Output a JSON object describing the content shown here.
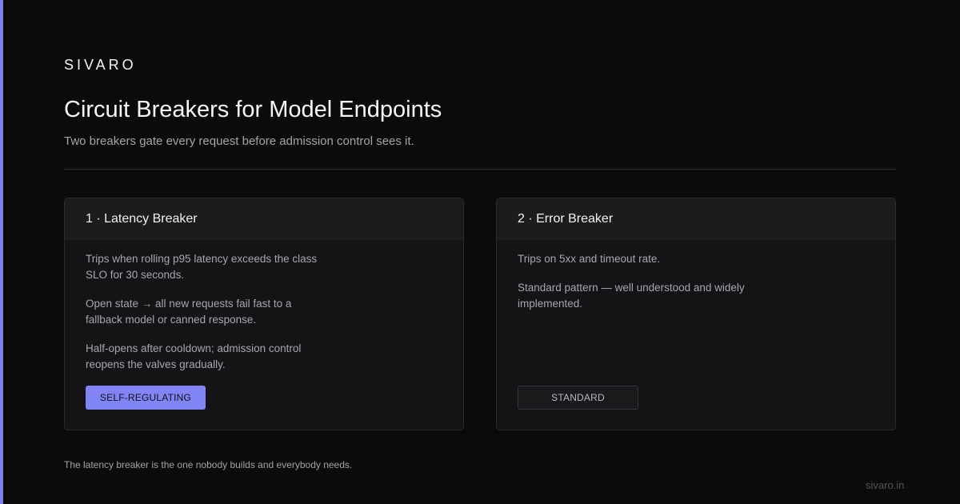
{
  "brand": "SIVARO",
  "title": "Circuit Breakers for Model Endpoints",
  "subtitle": "Two breakers gate every request before admission control sees it.",
  "cards": [
    {
      "title": "1 · Latency Breaker",
      "paragraphs": [
        "Trips when rolling p95 latency exceeds the class SLO for 30 seconds.",
        "Open state → all new requests fail fast to a fallback model or canned response.",
        "Half-opens after cooldown; admission control reopens the valves gradually."
      ],
      "badge": "SELF-REGULATING"
    },
    {
      "title": "2 · Error Breaker",
      "paragraphs": [
        "Trips on 5xx and timeout rate.",
        "Standard pattern — well understood and widely implemented."
      ],
      "badge": "STANDARD"
    }
  ],
  "footnote": "The latency breaker is the one nobody builds and everybody needs.",
  "site": "sivaro.in",
  "colors": {
    "accent": "#7b7ff2",
    "background": "#0b0b0c",
    "card": "#141416"
  }
}
